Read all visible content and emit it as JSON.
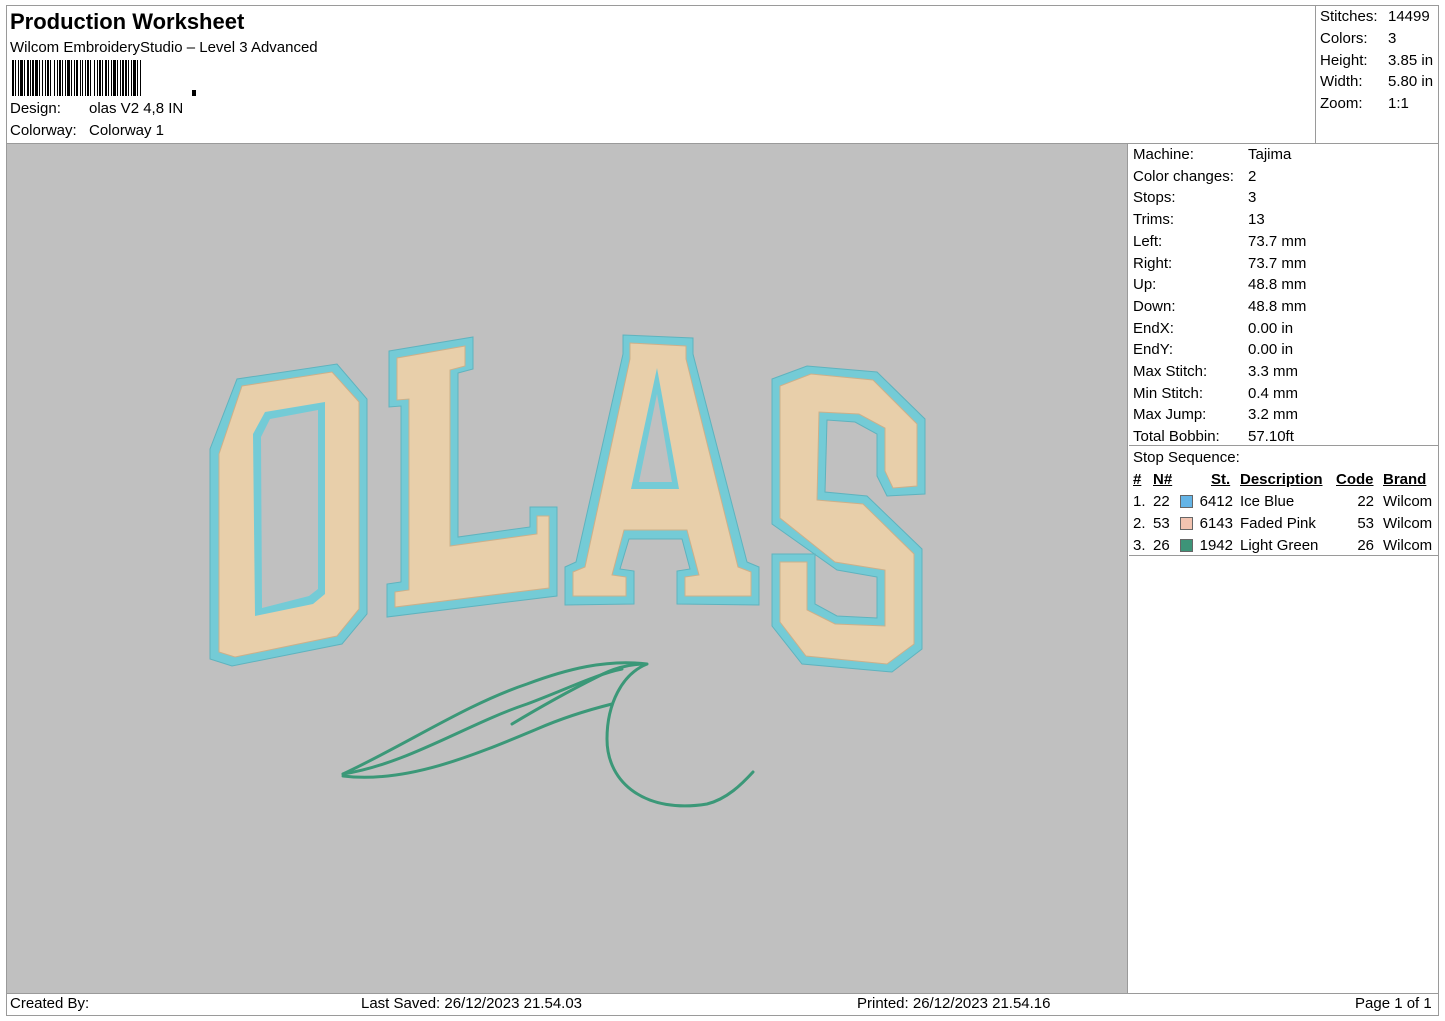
{
  "header": {
    "title": "Production Worksheet",
    "subtitle": "Wilcom EmbroideryStudio – Level 3 Advanced",
    "design_label": "Design:",
    "design_value": "olas V2 4,8 IN",
    "colorway_label": "Colorway:",
    "colorway_value": "Colorway 1"
  },
  "stats": {
    "stitches_label": "Stitches:",
    "stitches_value": "14499",
    "colors_label": "Colors:",
    "colors_value": "3",
    "height_label": "Height:",
    "height_value": "3.85 in",
    "width_label": "Width:",
    "width_value": "5.80 in",
    "zoom_label": "Zoom:",
    "zoom_value": "1:1"
  },
  "machine_info": [
    {
      "label": "Machine:",
      "value": "Tajima"
    },
    {
      "label": "Color changes:",
      "value": "2"
    },
    {
      "label": "Stops:",
      "value": "3"
    },
    {
      "label": "Trims:",
      "value": "13"
    },
    {
      "label": "Left:",
      "value": "73.7 mm"
    },
    {
      "label": "Right:",
      "value": "73.7 mm"
    },
    {
      "label": "Up:",
      "value": "48.8 mm"
    },
    {
      "label": "Down:",
      "value": "48.8 mm"
    },
    {
      "label": "EndX:",
      "value": "0.00 in"
    },
    {
      "label": "EndY:",
      "value": "0.00 in"
    },
    {
      "label": "Max Stitch:",
      "value": "3.3 mm"
    },
    {
      "label": "Min Stitch:",
      "value": "0.4 mm"
    },
    {
      "label": "Max Jump:",
      "value": "3.2 mm"
    },
    {
      "label": "Total Bobbin:",
      "value": "57.10ft"
    }
  ],
  "stop_sequence": {
    "title": "Stop Sequence:",
    "headers": {
      "num": "#",
      "n": "N#",
      "st": "St.",
      "description": "Description",
      "code": "Code",
      "brand": "Brand"
    },
    "rows": [
      {
        "num": "1.",
        "n": "22",
        "color": "#64b4e6",
        "st": "6412",
        "description": "Ice Blue",
        "code": "22",
        "brand": "Wilcom"
      },
      {
        "num": "2.",
        "n": "53",
        "color": "#f2c3b0",
        "st": "6143",
        "description": "Faded Pink",
        "code": "53",
        "brand": "Wilcom"
      },
      {
        "num": "3.",
        "n": "26",
        "color": "#3d9478",
        "st": "1942",
        "description": "Light Green",
        "code": "26",
        "brand": "Wilcom"
      }
    ]
  },
  "design": {
    "text": "OLAS",
    "outline_color": "#74cbd6",
    "inner_color": "#e8cfaa",
    "wave_color": "#3b9878"
  },
  "footer": {
    "created_by": "Created By:",
    "last_saved": "Last Saved: 26/12/2023 21.54.03",
    "printed": "Printed: 26/12/2023 21.54.16",
    "page": "Page 1 of 1"
  }
}
